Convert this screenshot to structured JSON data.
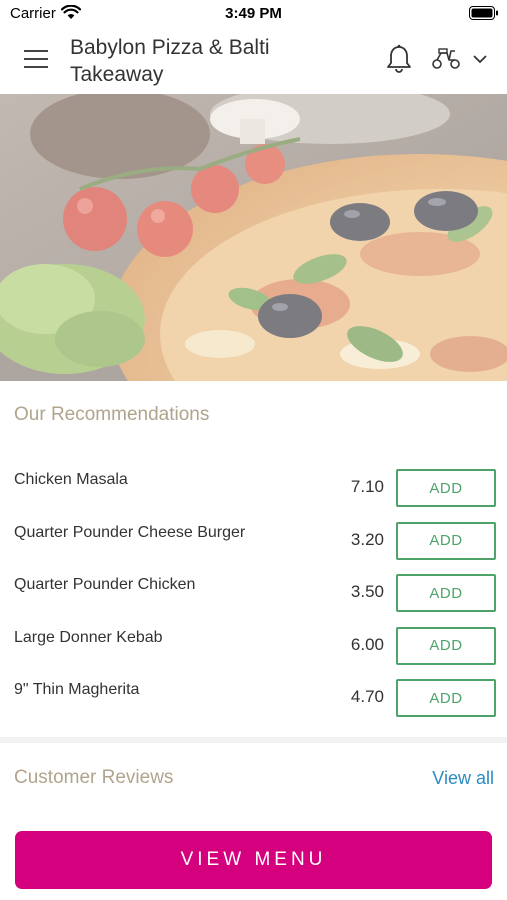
{
  "status_bar": {
    "carrier": "Carrier",
    "time": "3:49 PM"
  },
  "header": {
    "title": "Babylon Pizza & Balti Takeaway"
  },
  "recommendations": {
    "title": "Our Recommendations",
    "items": [
      {
        "name": "Chicken Masala",
        "price": "7.10",
        "button": "ADD"
      },
      {
        "name": "Quarter Pounder Cheese Burger",
        "price": "3.20",
        "button": "ADD"
      },
      {
        "name": "Quarter Pounder Chicken",
        "price": "3.50",
        "button": "ADD"
      },
      {
        "name": "Large Donner Kebab",
        "price": "6.00",
        "button": "ADD"
      },
      {
        "name": "9\" Thin Magherita",
        "price": "4.70",
        "button": "ADD"
      }
    ]
  },
  "reviews": {
    "title": "Customer Reviews",
    "view_all": "View all"
  },
  "footer": {
    "view_menu": "VIEW MENU"
  },
  "colors": {
    "accent": "#d4007e",
    "add_green": "#4ea36a",
    "section_title": "#b1a48d",
    "link": "#2b8cc4"
  }
}
